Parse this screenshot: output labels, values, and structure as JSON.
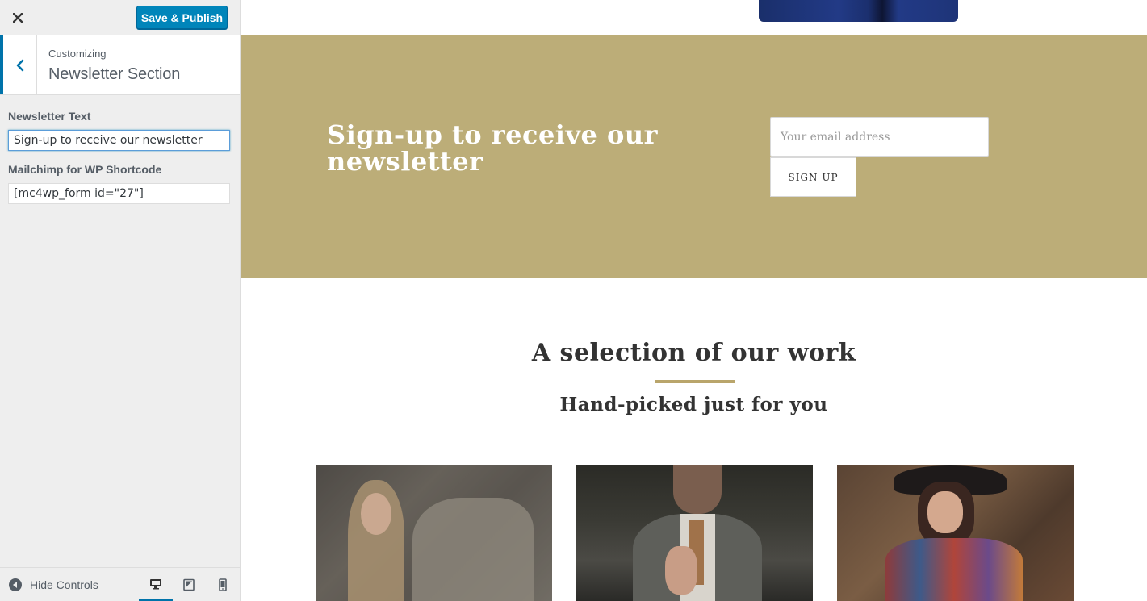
{
  "sidebar": {
    "close_icon": "close-icon",
    "publish_label": "Save & Publish",
    "customizing_label": "Customizing",
    "section_name": "Newsletter Section",
    "controls": {
      "newsletter_text_label": "Newsletter Text",
      "newsletter_text_value": "Sign-up to receive our newsletter",
      "mailchimp_label": "Mailchimp for WP Shortcode",
      "mailchimp_value": "[mc4wp_form id=\"27\"]"
    },
    "footer": {
      "hide_controls_label": "Hide Controls",
      "devices": [
        "desktop",
        "tablet",
        "mobile"
      ],
      "active_device": "desktop"
    }
  },
  "preview": {
    "newsletter": {
      "heading": "Sign-up to receive our newsletter",
      "email_placeholder": "Your email address",
      "signup_label": "SIGN UP",
      "background_color": "#bcad78"
    },
    "work": {
      "title": "A selection of our work",
      "subtitle": "Hand-picked just for you",
      "divider_color": "#b9a56b"
    }
  },
  "colors": {
    "accent": "#0073aa",
    "publish_button": "#0085ba"
  }
}
